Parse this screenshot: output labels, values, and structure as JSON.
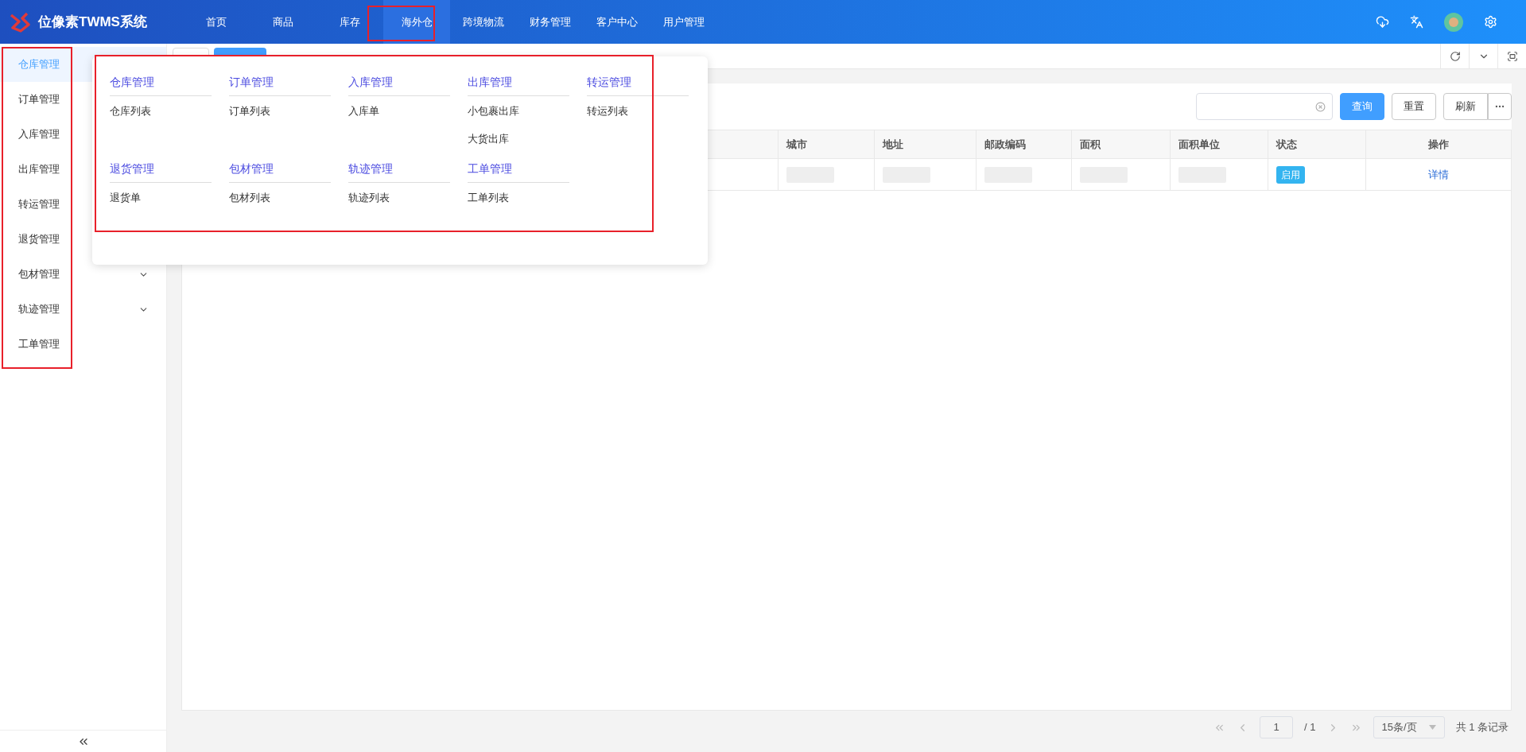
{
  "app": {
    "title": "位像素TWMS系统"
  },
  "nav": [
    {
      "label": "首页",
      "selected": false
    },
    {
      "label": "商品",
      "selected": false
    },
    {
      "label": "库存",
      "selected": false
    },
    {
      "label": "海外仓",
      "selected": true
    },
    {
      "label": "跨境物流",
      "selected": false
    },
    {
      "label": "财务管理",
      "selected": false
    },
    {
      "label": "客户中心",
      "selected": false
    },
    {
      "label": "用户管理",
      "selected": false
    }
  ],
  "sidebar": {
    "items": [
      {
        "label": "仓库管理",
        "selected": true
      },
      {
        "label": "订单管理",
        "selected": false
      },
      {
        "label": "入库管理",
        "selected": false
      },
      {
        "label": "出库管理",
        "selected": false
      },
      {
        "label": "转运管理",
        "selected": false
      },
      {
        "label": "退货管理",
        "selected": false
      },
      {
        "label": "包材管理",
        "selected": false,
        "has_submenu": true
      },
      {
        "label": "轨迹管理",
        "selected": false,
        "has_submenu": true
      },
      {
        "label": "工单管理",
        "selected": false
      }
    ]
  },
  "mega_menu": {
    "groups": [
      {
        "title": "仓库管理",
        "items": [
          "仓库列表"
        ]
      },
      {
        "title": "订单管理",
        "items": [
          "订单列表"
        ]
      },
      {
        "title": "入库管理",
        "items": [
          "入库单"
        ]
      },
      {
        "title": "出库管理",
        "items": [
          "小包裹出库",
          "大货出库"
        ]
      },
      {
        "title": "转运管理",
        "items": [
          "转运列表"
        ]
      },
      {
        "title": "退货管理",
        "items": [
          "退货单"
        ]
      },
      {
        "title": "包材管理",
        "items": [
          "包材列表"
        ]
      },
      {
        "title": "轨迹管理",
        "items": [
          "轨迹列表"
        ]
      },
      {
        "title": "工单管理",
        "items": [
          "工单列表"
        ]
      }
    ]
  },
  "toolbar": {
    "buttons": [
      {
        "label": "查询",
        "kind": "primary"
      },
      {
        "label": "重置",
        "kind": "default"
      },
      {
        "label": "刷新",
        "kind": "default"
      }
    ]
  },
  "table": {
    "columns": [
      "城市",
      "地址",
      "邮政编码",
      "面积",
      "面积单位",
      "状态",
      "操作"
    ],
    "rows": [
      {
        "status": "启用",
        "action": "详情"
      }
    ]
  },
  "pagination": {
    "page": "1",
    "total_pages": "/ 1",
    "page_size": "15条/页",
    "total": "共 1 条记录"
  }
}
